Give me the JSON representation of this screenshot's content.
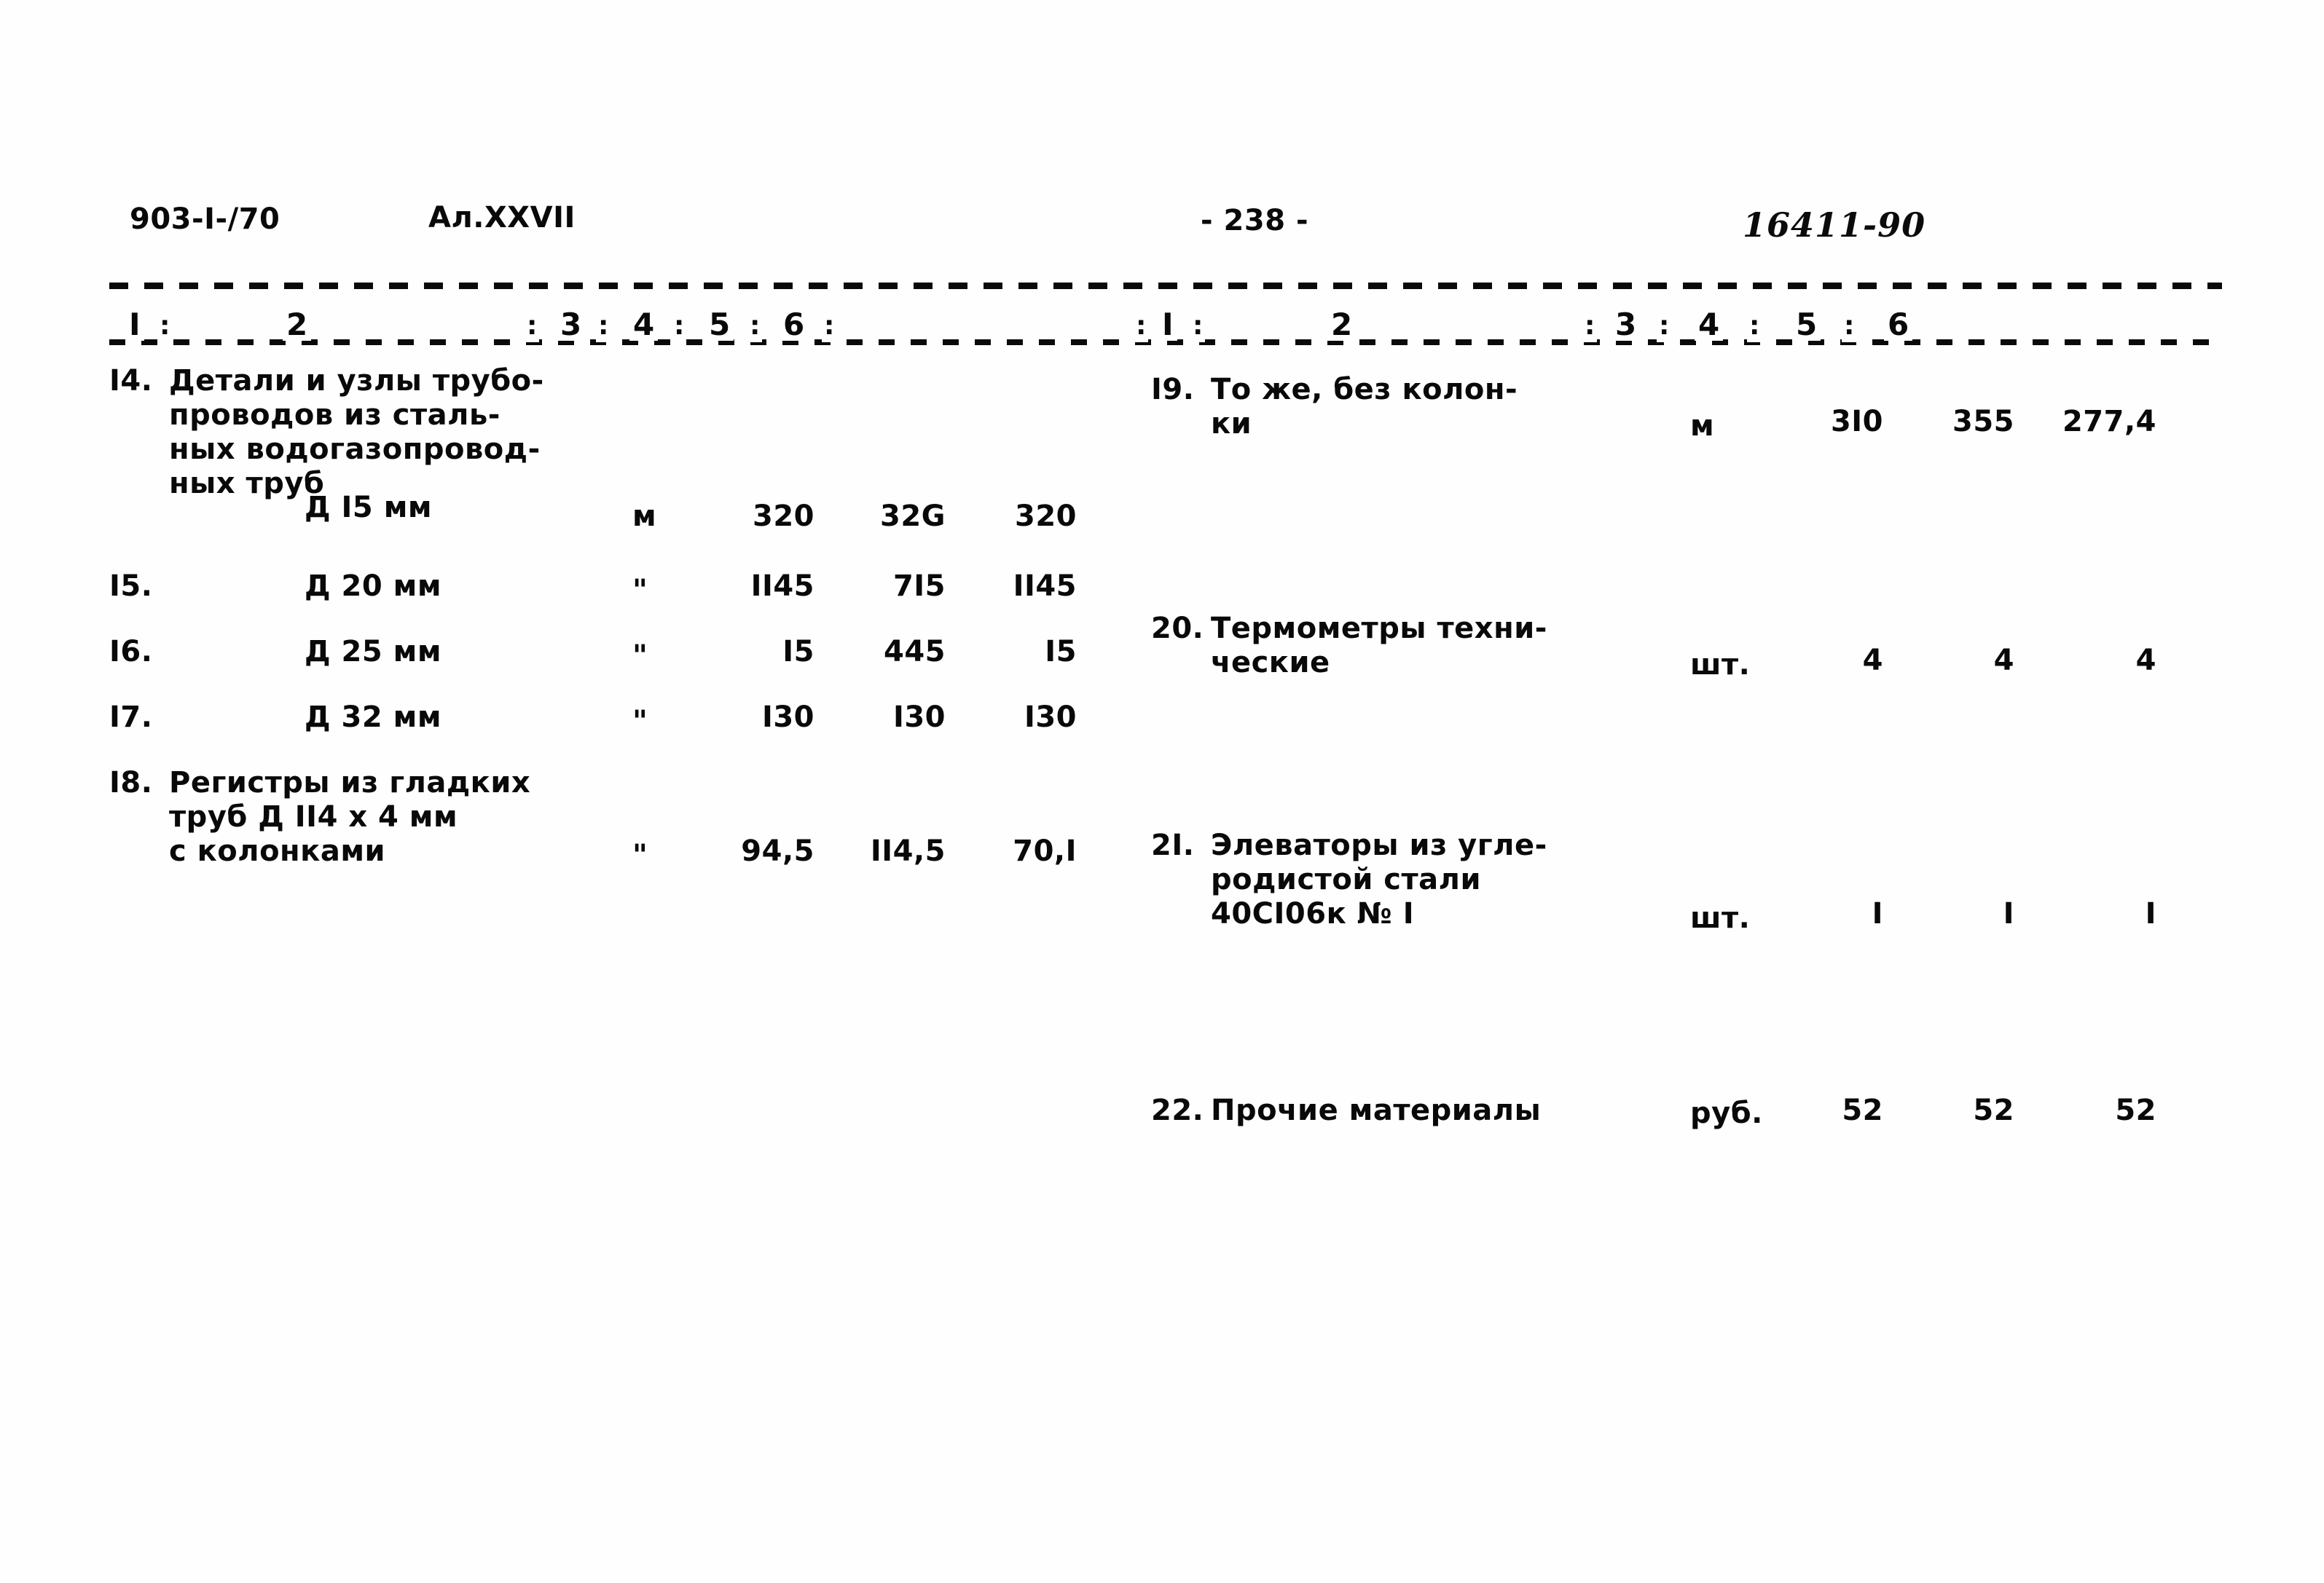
{
  "header": {
    "doc_code": "903-I-/70",
    "album": "Ал.XXVII",
    "page_number": "- 238 -",
    "stamp": "16411-90"
  },
  "column_header": {
    "left": [
      "I",
      "2",
      "3",
      "4",
      "5",
      "6"
    ],
    "right": [
      "I",
      "2",
      "3",
      "4",
      "5",
      "6"
    ],
    "separator": ":"
  },
  "table": {
    "left_rows": [
      {
        "num": "I4.",
        "desc_lines": [
          "Детали и узлы трубо-",
          "проводов из сталь-",
          "ных водогазопровод-",
          "ных труб"
        ],
        "sub": "Д I5 мм",
        "unit": "м",
        "v1": "320",
        "v2": "32G",
        "v3": "320"
      },
      {
        "num": "I5.",
        "desc_lines": [],
        "sub": "Д 20 мм",
        "unit": "\"",
        "v1": "II45",
        "v2": "7I5",
        "v3": "II45"
      },
      {
        "num": "I6.",
        "desc_lines": [],
        "sub": "Д 25 мм",
        "unit": "\"",
        "v1": "I5",
        "v2": "445",
        "v3": "I5"
      },
      {
        "num": "I7.",
        "desc_lines": [],
        "sub": "Д 32 мм",
        "unit": "\"",
        "v1": "I30",
        "v2": "I30",
        "v3": "I30"
      },
      {
        "num": "I8.",
        "desc_lines": [
          "Регистры из гладких",
          "труб Д II4 х 4 мм",
          "с колонками"
        ],
        "sub": "",
        "unit": "\"",
        "v1": "94,5",
        "v2": "II4,5",
        "v3": "70,I"
      }
    ],
    "right_rows": [
      {
        "num": "I9.",
        "desc_lines": [
          "То же, без колон-",
          "ки"
        ],
        "unit": "м",
        "v1": "3I0",
        "v2": "355",
        "v3": "277,4"
      },
      {
        "num": "20.",
        "desc_lines": [
          "Термометры техни-",
          "ческие"
        ],
        "unit": "шт.",
        "v1": "4",
        "v2": "4",
        "v3": "4"
      },
      {
        "num": "2I.",
        "desc_lines": [
          "Элеваторы из угле-",
          "родистой стали",
          "40СI06к № I"
        ],
        "unit": "шт.",
        "v1": "I",
        "v2": "I",
        "v3": "I"
      },
      {
        "num": "22.",
        "desc_lines": [
          "Прочие материалы"
        ],
        "unit": "руб.",
        "v1": "52",
        "v2": "52",
        "v3": "52"
      }
    ]
  }
}
